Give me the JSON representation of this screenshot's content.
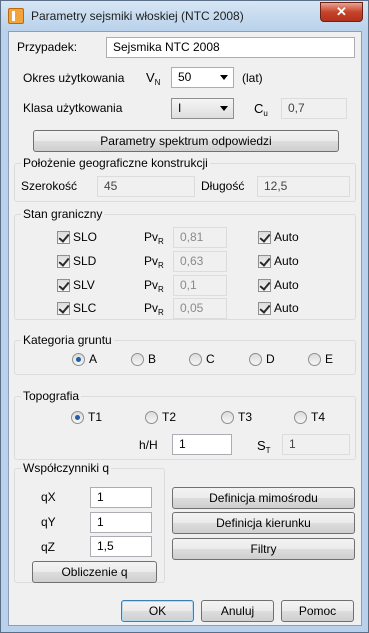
{
  "window": {
    "title": "Parametry sejsmiki włoskiej (NTC 2008)",
    "close_label": "✕"
  },
  "case": {
    "label": "Przypadek:",
    "value": "Sejsmika NTC 2008"
  },
  "service_life": {
    "label": "Okres użytkowania",
    "symbol": "V",
    "symbol_sub": "N",
    "value": "50",
    "unit": "(lat)"
  },
  "use_class": {
    "label": "Klasa użytkowania",
    "value": "I",
    "coef_symbol": "C",
    "coef_sub": "u",
    "coef_value": "0,7"
  },
  "spectrum_button": "Parametry spektrum odpowiedzi",
  "location": {
    "title": "Położenie geograficzne konstrukcji",
    "lat_label": "Szerokość",
    "lat_value": "45",
    "lon_label": "Długość",
    "lon_value": "12,5"
  },
  "limit_states": {
    "title": "Stan graniczny",
    "pvr_symbol": "Pv",
    "pvr_sub": "R",
    "auto_label": "Auto",
    "rows": [
      {
        "name": "SLO",
        "checked": true,
        "pvr": "0,81",
        "auto": true
      },
      {
        "name": "SLD",
        "checked": true,
        "pvr": "0,63",
        "auto": true
      },
      {
        "name": "SLV",
        "checked": true,
        "pvr": "0,1",
        "auto": true
      },
      {
        "name": "SLC",
        "checked": true,
        "pvr": "0,05",
        "auto": true
      }
    ]
  },
  "soil": {
    "title": "Kategoria gruntu",
    "options": [
      "A",
      "B",
      "C",
      "D",
      "E"
    ],
    "selected": "A"
  },
  "topography": {
    "title": "Topografia",
    "options": [
      "T1",
      "T2",
      "T3",
      "T4"
    ],
    "selected": "T1",
    "hH_label": "h/H",
    "hH_value": "1",
    "st_symbol": "S",
    "st_sub": "T",
    "st_value": "1"
  },
  "q_factors": {
    "title": "Współczynniki q",
    "qx_label": "qX",
    "qx_value": "1",
    "qy_label": "qY",
    "qy_value": "1",
    "qz_label": "qZ",
    "qz_value": "1,5",
    "calc_button": "Obliczenie q"
  },
  "side_buttons": {
    "eccentricity": "Definicja mimośrodu",
    "direction": "Definicja kierunku",
    "filters": "Filtry"
  },
  "footer": {
    "ok": "OK",
    "cancel": "Anuluj",
    "help": "Pomoc"
  }
}
